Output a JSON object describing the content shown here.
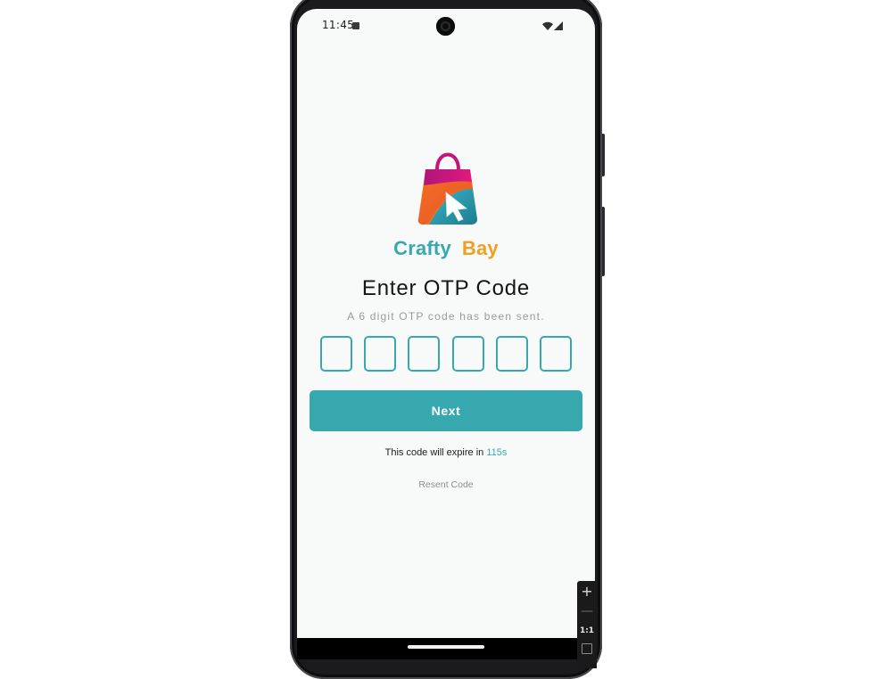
{
  "status_bar": {
    "time": "11:45",
    "icons": [
      "notification-a-icon",
      "camera-cutout",
      "wifi-icon",
      "signal-icon"
    ]
  },
  "brand": {
    "name_part_1": "Crafty",
    "name_part_2": "Bay",
    "logo_icon": "shopping-bag-cursor-icon",
    "color_part_1": "#37a8ae",
    "color_part_2": "#f0a020"
  },
  "otp_screen": {
    "title": "Enter OTP Code",
    "subtitle": "A 6 digit OTP code has been sent.",
    "otp_digits": [
      "",
      "",
      "",
      "",
      "",
      ""
    ],
    "next_label": "Next",
    "expire_prefix": "This code will expire in",
    "expire_count": "115s",
    "resend_label": "Resent Code"
  },
  "emulator_toolbar": {
    "zoom_in": "+",
    "zoom_out": "—",
    "actual_size": "1:1",
    "icons": [
      "zoom-in-icon",
      "zoom-out-icon",
      "fit-screen-icon"
    ]
  },
  "colors": {
    "accent": "#37a8ae",
    "brand_orange": "#f0a020",
    "screen_background": "#f8faf9"
  }
}
